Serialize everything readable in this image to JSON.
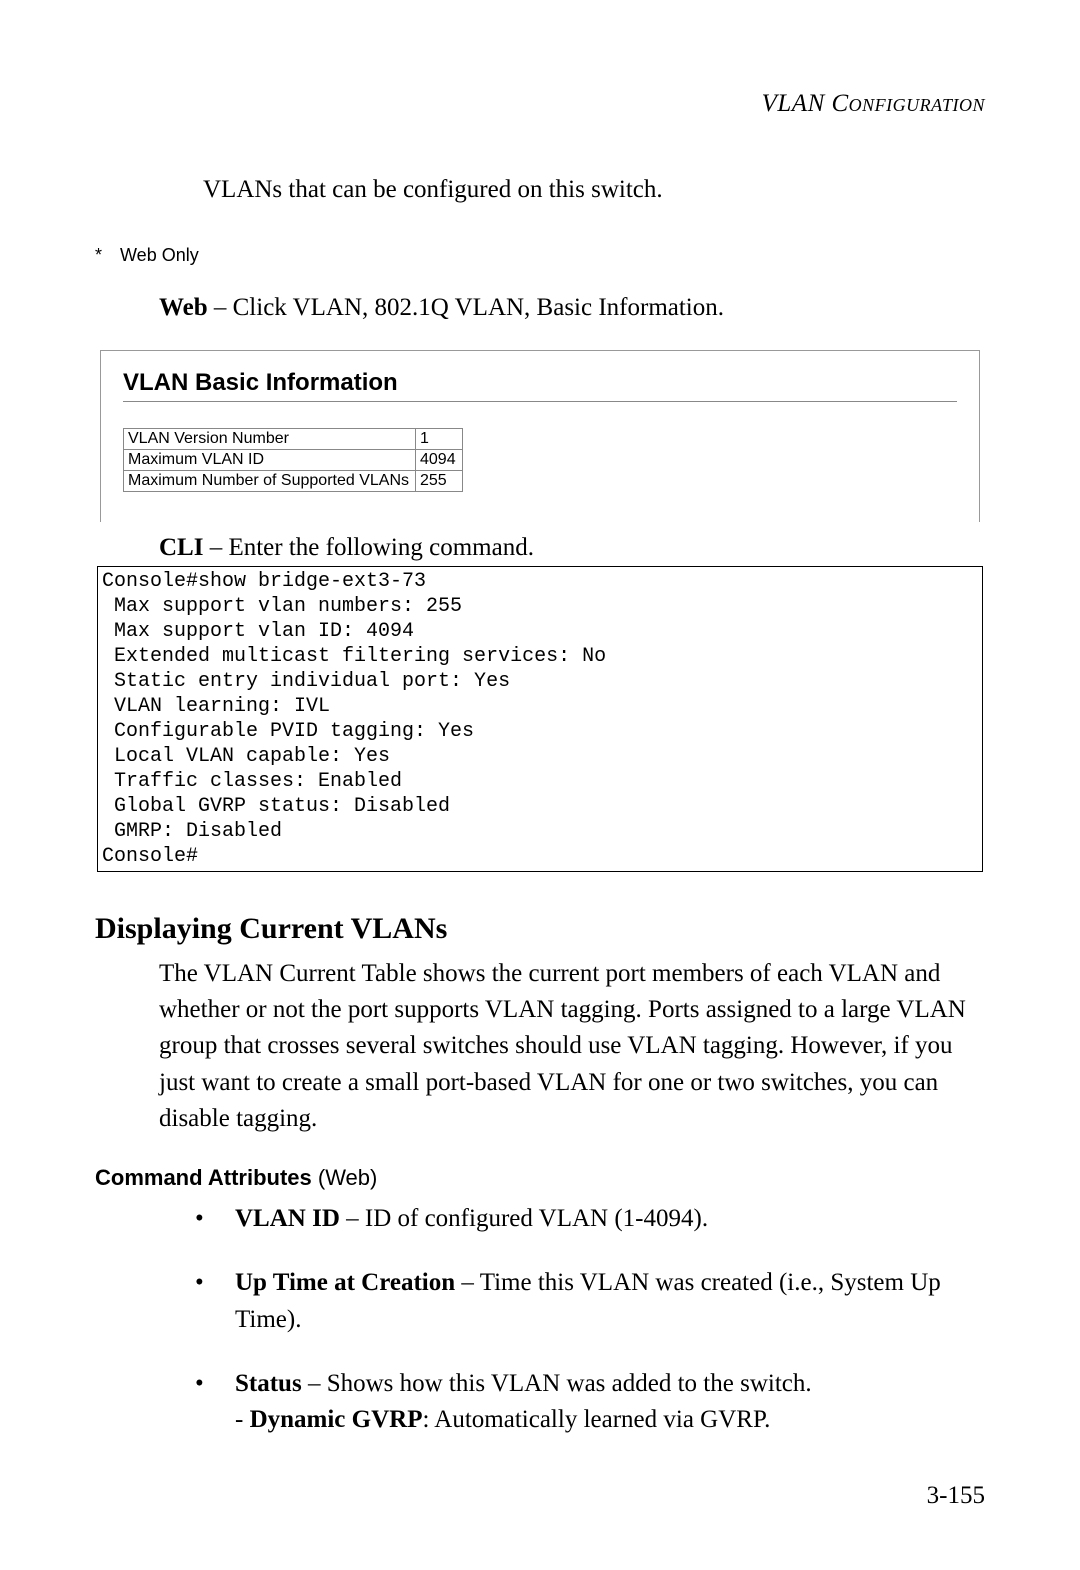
{
  "header": "VLAN Configuration",
  "intro": "VLANs that can be configured on this switch.",
  "footnote": "Web Only",
  "web_instruction_bold": "Web",
  "web_instruction_rest": " – Click VLAN, 802.1Q VLAN, Basic Information.",
  "screenshot": {
    "title": "VLAN Basic Information",
    "rows": [
      {
        "label": "VLAN Version Number",
        "value": "1"
      },
      {
        "label": "Maximum VLAN ID",
        "value": "4094"
      },
      {
        "label": "Maximum Number of Supported VLANs",
        "value": "255"
      }
    ]
  },
  "cli_instruction_bold": "CLI",
  "cli_instruction_rest": " – Enter the following command.",
  "cli_output": "Console#show bridge-ext3-73\n Max support vlan numbers: 255\n Max support vlan ID: 4094\n Extended multicast filtering services: No\n Static entry individual port: Yes\n VLAN learning: IVL\n Configurable PVID tagging: Yes\n Local VLAN capable: Yes\n Traffic classes: Enabled\n Global GVRP status: Disabled\n GMRP: Disabled\nConsole#",
  "section_heading": "Displaying Current VLANs",
  "section_para": "The VLAN Current Table shows the current port members of each VLAN and whether or not the port supports VLAN tagging. Ports assigned to a large VLAN group that crosses several switches should use VLAN tagging. However, if you just want to create a small port-based VLAN for one or two switches, you can disable tagging.",
  "cmd_attr_heading_bold": "Command Attributes",
  "cmd_attr_heading_rest": " (Web)",
  "attrs": [
    {
      "term": "VLAN ID",
      "desc": " – ID of configured VLAN (1-4094)."
    },
    {
      "term": "Up Time at Creation",
      "desc": " – Time this VLAN was created (i.e., System Up Time)."
    },
    {
      "term": "Status",
      "desc": " – Shows how this VLAN was added to the switch.",
      "sub_term": "Dynamic GVRP",
      "sub_desc": ": Automatically learned via GVRP."
    }
  ],
  "page_number": "3-155"
}
